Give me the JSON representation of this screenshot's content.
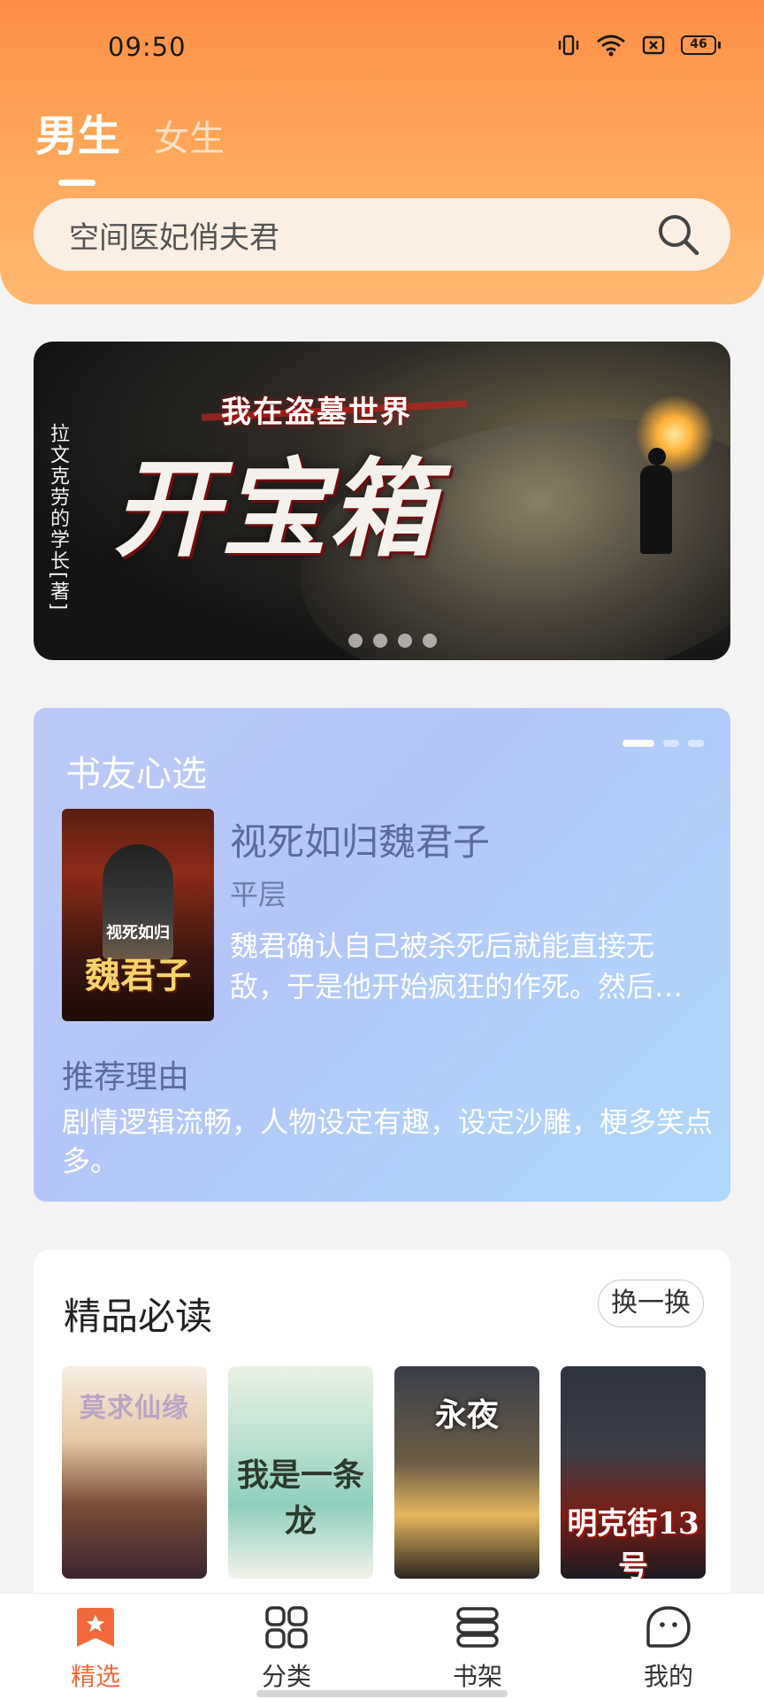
{
  "status_bar": {
    "time": "09:50",
    "battery": "46"
  },
  "tabs": {
    "male": "男生",
    "female": "女生"
  },
  "search": {
    "placeholder": "空间医妃俏夫君"
  },
  "banner": {
    "subtitle": "我在盗墓世界",
    "title": "开宝箱",
    "author": "拉文克劳的学长",
    "author_note": "[著]",
    "dots": 4
  },
  "picks": {
    "section_title": "书友心选",
    "book_title": "视死如归魏君子",
    "author": "平层",
    "description": "魏君确认自己被杀死后就能直接无敌，于是他开始疯狂的作死。然后…",
    "reason_title": "推荐理由",
    "reason": "剧情逻辑流畅，人物设定有趣，设定沙雕，梗多笑点多。",
    "cover": {
      "top": "视死如归",
      "title": "魏君子"
    }
  },
  "must_read": {
    "title": "精品必读",
    "refresh_label": "换一换",
    "books": [
      {
        "cover_title": "莫求仙缘"
      },
      {
        "cover_title": "我是一条龙"
      },
      {
        "cover_title": "永夜"
      },
      {
        "cover_title": "明克街13号"
      }
    ]
  },
  "nav": {
    "items": [
      {
        "label": "精选",
        "icon": "bookmark-star-icon",
        "active": true
      },
      {
        "label": "分类",
        "icon": "grid-icon",
        "active": false
      },
      {
        "label": "书架",
        "icon": "bookshelf-icon",
        "active": false
      },
      {
        "label": "我的",
        "icon": "profile-face-icon",
        "active": false
      }
    ]
  },
  "colors": {
    "accent": "#f36a3a",
    "header_top": "#ff8f45",
    "header_bottom": "#ffb872"
  }
}
